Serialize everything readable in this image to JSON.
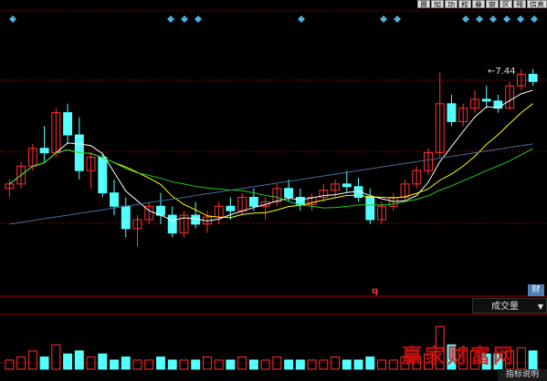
{
  "toolbar": {
    "buttons": [
      "周",
      "加",
      "功",
      "权",
      "叠",
      "窗",
      "区",
      "预",
      "信息"
    ]
  },
  "price_label": "←7.44",
  "marker_q": "q",
  "finance_tag": "财",
  "indicator": {
    "selected": "成交量",
    "arrow": "▼"
  },
  "indicator_help": "指标说明",
  "watermark": "赢家财富网",
  "colors": {
    "up": "#ff3232",
    "down": "#54ffff",
    "ma5": "#ffffff",
    "ma10": "#ffff00",
    "ma20": "#22cc22",
    "ma60": "#4a6a9a",
    "grid": "#8b0000",
    "diamond": "#4fb0e0"
  },
  "chart_data": {
    "type": "candlestick",
    "candles": [
      [
        6.1,
        6.2,
        6.0,
        6.15
      ],
      [
        6.15,
        6.4,
        6.1,
        6.35
      ],
      [
        6.35,
        6.6,
        6.3,
        6.55
      ],
      [
        6.55,
        6.8,
        6.4,
        6.5
      ],
      [
        6.5,
        7.0,
        6.45,
        6.95
      ],
      [
        6.95,
        7.05,
        6.6,
        6.7
      ],
      [
        6.7,
        6.9,
        6.2,
        6.3
      ],
      [
        6.3,
        6.5,
        6.1,
        6.45
      ],
      [
        6.45,
        6.5,
        6.0,
        6.05
      ],
      [
        6.05,
        6.2,
        5.8,
        5.9
      ],
      [
        5.9,
        6.0,
        5.55,
        5.65
      ],
      [
        5.65,
        5.8,
        5.45,
        5.75
      ],
      [
        5.75,
        5.95,
        5.7,
        5.9
      ],
      [
        5.9,
        6.05,
        5.7,
        5.8
      ],
      [
        5.8,
        5.9,
        5.55,
        5.6
      ],
      [
        5.6,
        5.85,
        5.55,
        5.8
      ],
      [
        5.8,
        5.95,
        5.65,
        5.7
      ],
      [
        5.7,
        5.85,
        5.6,
        5.78
      ],
      [
        5.78,
        5.95,
        5.7,
        5.9
      ],
      [
        5.9,
        6.0,
        5.75,
        5.85
      ],
      [
        5.85,
        6.05,
        5.8,
        6.0
      ],
      [
        6.0,
        6.1,
        5.85,
        5.9
      ],
      [
        5.9,
        6.0,
        5.75,
        5.95
      ],
      [
        5.95,
        6.15,
        5.9,
        6.1
      ],
      [
        6.1,
        6.2,
        5.95,
        6.0
      ],
      [
        6.0,
        6.1,
        5.85,
        5.92
      ],
      [
        5.92,
        6.05,
        5.85,
        6.0
      ],
      [
        6.0,
        6.15,
        5.95,
        6.08
      ],
      [
        6.08,
        6.2,
        6.0,
        6.15
      ],
      [
        6.15,
        6.3,
        6.05,
        6.12
      ],
      [
        6.12,
        6.22,
        5.95,
        6.0
      ],
      [
        6.0,
        6.1,
        5.7,
        5.75
      ],
      [
        5.75,
        5.95,
        5.7,
        5.9
      ],
      [
        5.9,
        6.05,
        5.85,
        6.0
      ],
      [
        6.0,
        6.2,
        5.95,
        6.15
      ],
      [
        6.15,
        6.35,
        6.1,
        6.3
      ],
      [
        6.3,
        6.55,
        6.25,
        6.5
      ],
      [
        6.5,
        7.4,
        6.45,
        7.05
      ],
      [
        7.05,
        7.15,
        6.8,
        6.85
      ],
      [
        6.85,
        7.05,
        6.8,
        7.0
      ],
      [
        7.0,
        7.2,
        6.95,
        7.1
      ],
      [
        7.1,
        7.25,
        7.0,
        7.08
      ],
      [
        7.08,
        7.15,
        6.95,
        7.0
      ],
      [
        7.0,
        7.3,
        6.98,
        7.25
      ],
      [
        7.25,
        7.44,
        7.2,
        7.38
      ],
      [
        7.38,
        7.44,
        7.25,
        7.3
      ]
    ],
    "ma60": [
      5.7,
      5.72,
      5.74,
      5.76,
      5.78,
      5.8,
      5.82,
      5.84,
      5.86,
      5.88,
      5.9,
      5.92,
      5.94,
      5.96,
      5.98,
      6.0,
      6.02,
      6.04,
      6.06,
      6.08,
      6.1,
      6.12,
      6.14,
      6.16,
      6.18,
      6.2,
      6.22,
      6.24,
      6.26,
      6.28,
      6.3,
      6.32,
      6.34,
      6.36,
      6.38,
      6.4,
      6.42,
      6.44,
      6.46,
      6.48,
      6.5,
      6.52,
      6.54,
      6.56,
      6.58,
      6.6
    ],
    "volumes": [
      3,
      4,
      6,
      4,
      8,
      5,
      6,
      4,
      5,
      3,
      4,
      3,
      3,
      4,
      3,
      3,
      3,
      4,
      3,
      3,
      4,
      3,
      3,
      4,
      3,
      3,
      3,
      3,
      4,
      3,
      3,
      4,
      3,
      3,
      4,
      4,
      5,
      14,
      8,
      7,
      6,
      5,
      5,
      6,
      7,
      6
    ]
  }
}
